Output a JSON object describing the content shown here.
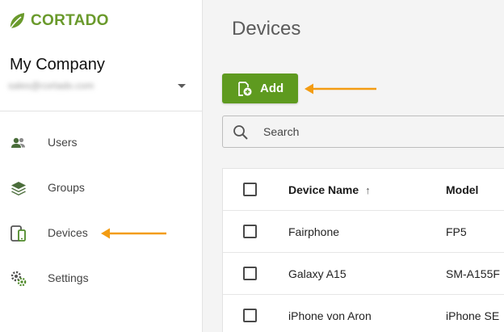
{
  "brand": {
    "name": "CORTADO",
    "color": "#6a9a2c"
  },
  "account": {
    "company": "My Company",
    "email": "sales@cortado.com"
  },
  "sidebar": {
    "items": [
      {
        "label": "Users",
        "icon": "users-icon"
      },
      {
        "label": "Groups",
        "icon": "layers-icon"
      },
      {
        "label": "Devices",
        "icon": "devices-icon"
      },
      {
        "label": "Settings",
        "icon": "gears-icon"
      }
    ]
  },
  "main": {
    "title": "Devices",
    "add_label": "Add",
    "add_color": "#5e9a1f",
    "search_placeholder": "Search",
    "table": {
      "columns": [
        "Device Name",
        "Model"
      ],
      "sort_indicator": "↑",
      "rows": [
        {
          "name": "Fairphone",
          "model": "FP5"
        },
        {
          "name": "Galaxy A15",
          "model": "SM-A155F"
        },
        {
          "name": "iPhone von Aron",
          "model": "iPhone SE"
        }
      ]
    }
  },
  "annotation_color": "#f39c12"
}
